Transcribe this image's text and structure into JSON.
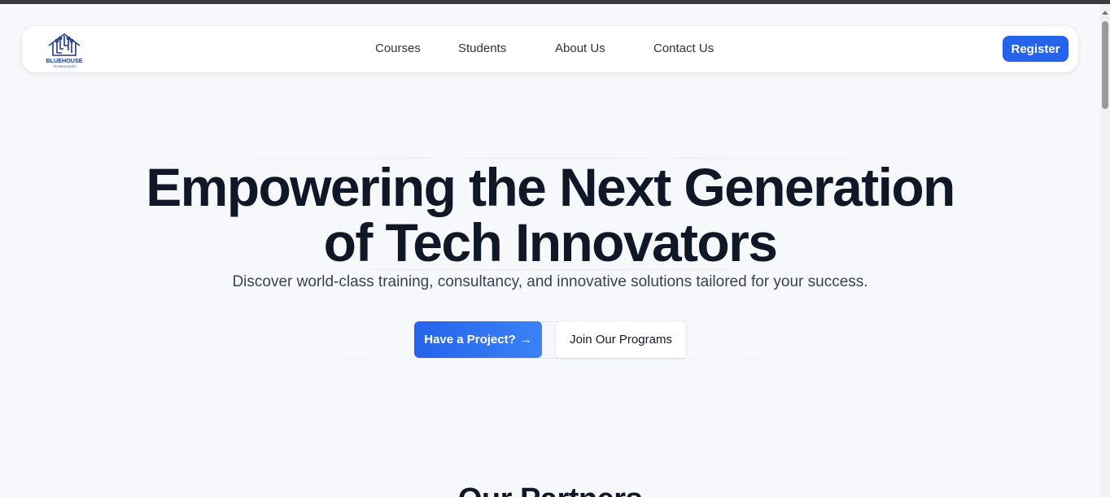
{
  "brand": {
    "logo_text": "BLUEHOUSE",
    "logo_subtext": "TECHNOLOGIES",
    "accent": "#2563eb",
    "logo_color": "#1e3a8a"
  },
  "nav": {
    "links": [
      {
        "label": "Courses"
      },
      {
        "label": "Students"
      },
      {
        "label": "About Us"
      },
      {
        "label": "Contact Us"
      }
    ],
    "register_label": "Register"
  },
  "hero": {
    "title_line1": "Empowering the Next Generation",
    "title_line2": "of Tech Innovators",
    "subtitle": "Discover world-class training, consultancy, and innovative solutions tailored for your success.",
    "primary_cta": "Have a Project?",
    "primary_cta_icon": "arrow-right-icon",
    "secondary_cta": "Join Our Programs"
  },
  "partners": {
    "title": "Our Partners"
  }
}
